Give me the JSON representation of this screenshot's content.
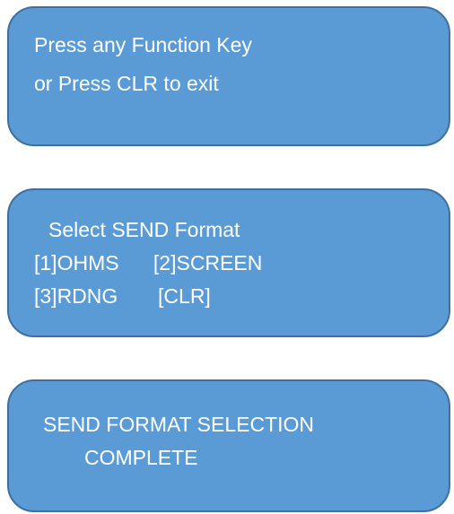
{
  "screens": [
    {
      "lines": [
        "Press any Function Key",
        "or Press CLR to exit"
      ]
    },
    {
      "lines": [
        "Select SEND Format",
        "[1]OHMS      [2]SCREEN",
        "[3]RDNG       [CLR]"
      ]
    },
    {
      "lines": [
        "SEND FORMAT SELECTION",
        "COMPLETE"
      ]
    }
  ],
  "colors": {
    "screen_fill": "#5b9bd5",
    "screen_border": "#3f6f9f",
    "text": "#ffffff"
  }
}
